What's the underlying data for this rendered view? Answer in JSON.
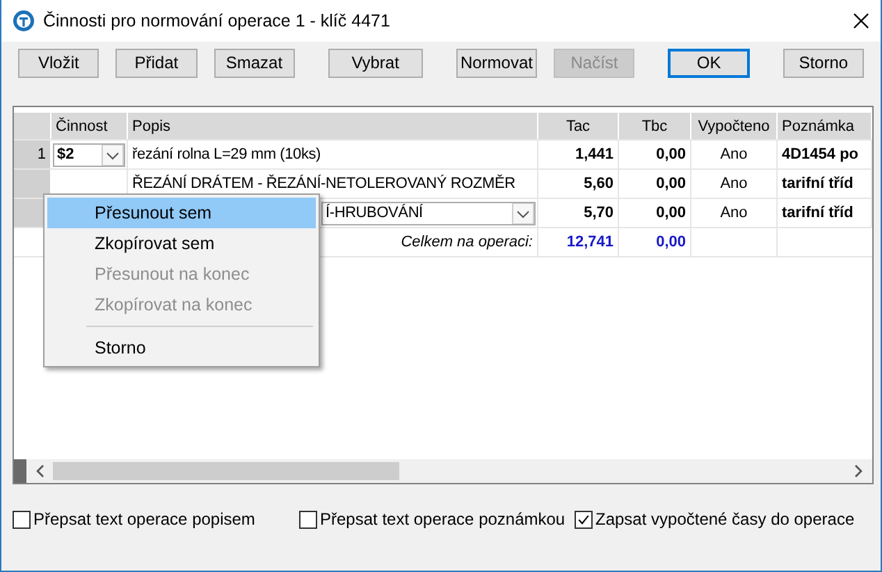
{
  "window": {
    "title": "Činnosti pro normování operace 1 - klíč 4471"
  },
  "buttons": [
    {
      "label": "Vložit",
      "disabled": false,
      "default": false
    },
    {
      "label": "Přidat",
      "disabled": false,
      "default": false
    },
    {
      "label": "Smazat",
      "disabled": false,
      "default": false
    },
    {
      "label": "Vybrat",
      "disabled": false,
      "default": false
    },
    {
      "label": "Normovat",
      "disabled": false,
      "default": false
    },
    {
      "label": "Načíst",
      "disabled": true,
      "default": false
    },
    {
      "label": "OK",
      "disabled": false,
      "default": true
    },
    {
      "label": "Storno",
      "disabled": false,
      "default": false
    }
  ],
  "table": {
    "columns": [
      "Činnost",
      "Popis",
      "Tac",
      "Tbc",
      "Vypočteno",
      "Poznámka"
    ],
    "rows": [
      {
        "number": "1",
        "cinnost": "$2",
        "popis": "řezání rolna L=29 mm (10ks)",
        "editing": false,
        "tac": "1,441",
        "tbc": "0,00",
        "vypocteno": "Ano",
        "poznamka": "4D1454 po"
      },
      {
        "popis": "ŘEZÁNÍ DRÁTEM - ŘEZÁNÍ-NETOLEROVANÝ ROZMĚR",
        "editing": false,
        "tac": "5,60",
        "tbc": "0,00",
        "vypocteno": "Ano",
        "poznamka": "tarifní tříd"
      },
      {
        "popis": "Í-HRUBOVÁNÍ",
        "editing": true,
        "tac": "5,70",
        "tbc": "0,00",
        "vypocteno": "Ano",
        "poznamka": "tarifní tříd"
      }
    ],
    "total": {
      "label": "Celkem na operaci:",
      "tac": "12,741",
      "tbc": "0,00"
    }
  },
  "context_menu": {
    "items": [
      {
        "kind": "item",
        "label": "Přesunout sem",
        "selected": true,
        "disabled": false
      },
      {
        "kind": "item",
        "label": "Zkopírovat sem",
        "selected": false,
        "disabled": false
      },
      {
        "kind": "item",
        "label": "Přesunout na konec",
        "selected": false,
        "disabled": true
      },
      {
        "kind": "item",
        "label": "Zkopírovat na konec",
        "selected": false,
        "disabled": true
      },
      {
        "kind": "separator"
      },
      {
        "kind": "item",
        "label": "Storno",
        "selected": false,
        "disabled": false
      }
    ]
  },
  "options": [
    {
      "label": "Přepsat text operace popisem",
      "checked": false
    },
    {
      "label": "Přepsat text operace poznámkou",
      "checked": false
    },
    {
      "label": "Zapsat vypočtené časy do operace",
      "checked": true
    }
  ]
}
